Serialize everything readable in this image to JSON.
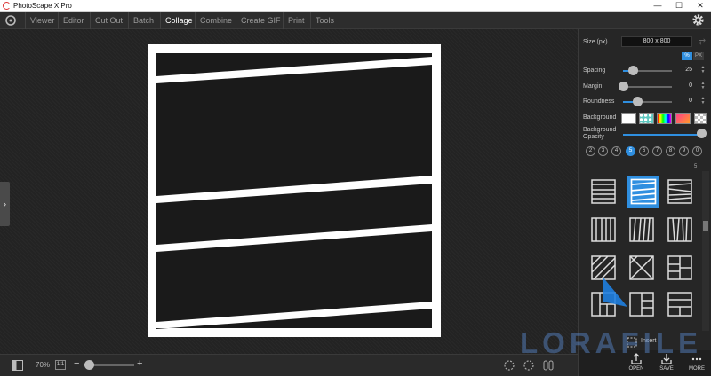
{
  "window": {
    "title": "PhotoScape X Pro",
    "minimize": "—",
    "maximize": "☐",
    "close": "✕"
  },
  "menu": {
    "items": [
      {
        "label": "Viewer",
        "active": false
      },
      {
        "label": "Editor",
        "active": false
      },
      {
        "label": "Cut Out",
        "active": false
      },
      {
        "label": "Batch",
        "active": false
      },
      {
        "label": "Collage",
        "active": true
      },
      {
        "label": "Combine",
        "active": false
      },
      {
        "label": "Create GIF",
        "active": false
      },
      {
        "label": "Print",
        "active": false
      },
      {
        "label": "Tools",
        "active": false
      }
    ]
  },
  "panel": {
    "size_label": "Size (px)",
    "size_value": "800 x 800",
    "unit_percent": "%",
    "unit_px": "PX",
    "spacing_label": "Spacing",
    "spacing_value": "25",
    "margin_label": "Margin",
    "margin_value": "0",
    "roundness_label": "Roundness",
    "roundness_value": "0",
    "background_label": "Background",
    "background_opacity_label_1": "Background",
    "background_opacity_label_2": "Opacity",
    "background_opacity_level": 1.0,
    "spacing_level": 0.2,
    "margin_level": 0.0,
    "roundness_level": 0.3,
    "photo_counts": [
      "2",
      "3",
      "4",
      "5",
      "6",
      "7",
      "8",
      "9",
      "0"
    ],
    "selected_count": "5",
    "layout_count_label": "5",
    "insert_label": "Insert",
    "open_label": "OPEN",
    "save_label": "SAVE",
    "more_label": "MORE"
  },
  "bottom": {
    "zoom_text": "70%",
    "one_to_one": "1:1",
    "zoom_minus": "−",
    "zoom_plus": "+",
    "zoom_level": 0.12
  },
  "watermark": {
    "text": "LORAFILE"
  },
  "colors": {
    "accent": "#2f8fe0",
    "canvas_bg": "#232323",
    "frame": "#ffffff"
  }
}
